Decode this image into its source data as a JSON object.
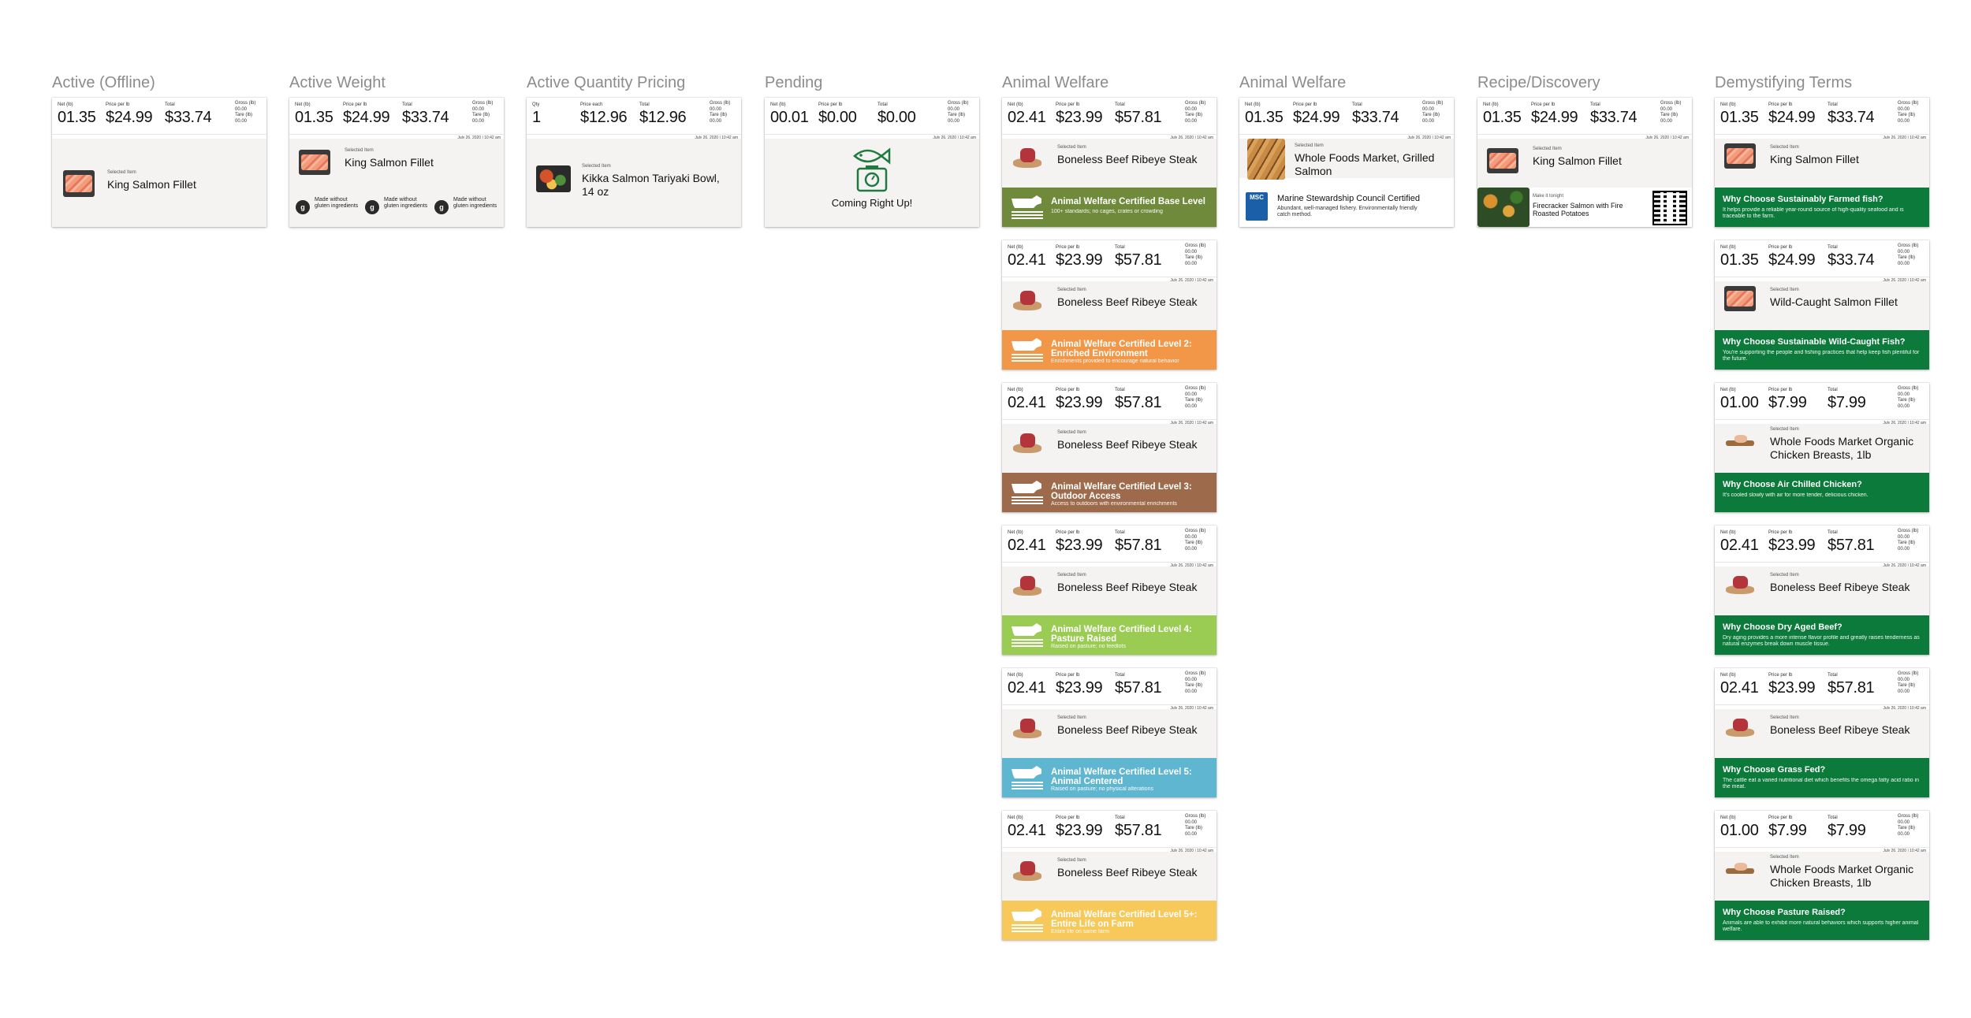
{
  "columns": [
    {
      "title": "Active (Offline)",
      "cards": [
        {
          "type": "basic",
          "qty_mode": false,
          "net_label": "Net (lb)",
          "net": "01.35",
          "price_label": "Price per lb",
          "price": "$24.99",
          "total_label": "Total",
          "total": "$33.74",
          "gross_label": "Gross (lb)",
          "gross": "00.00",
          "tare_label": "Tare (lb)",
          "tare": "00.00",
          "date": "",
          "selected_label": "Selected Item",
          "item": "King Salmon Fillet",
          "thumb": "salmon"
        }
      ]
    },
    {
      "title": "Active Weight",
      "cards": [
        {
          "type": "gluten",
          "net_label": "Net (lb)",
          "net": "01.35",
          "price_label": "Price per lb",
          "price": "$24.99",
          "total_label": "Total",
          "total": "$33.74",
          "gross_label": "Gross (lb)",
          "gross": "00.00",
          "tare_label": "Tare (lb)",
          "tare": "00.00",
          "date": "July 26, 2020 | 10:42 am",
          "selected_label": "Selected Item",
          "item": "King Salmon Fillet",
          "thumb": "salmon",
          "icons": [
            {
              "text": "Made without gluten ingredients"
            },
            {
              "text": "Made without gluten ingredients"
            },
            {
              "text": "Made without gluten ingredients"
            }
          ]
        }
      ]
    },
    {
      "title": "Active Quantity Pricing",
      "cards": [
        {
          "type": "basic",
          "net_label": "Qty",
          "net": "1",
          "price_label": "Price each",
          "price": "$12.96",
          "total_label": "Total",
          "total": "$12.96",
          "gross_label": "Gross (lb)",
          "gross": "00.00",
          "tare_label": "Tare (lb)",
          "tare": "00.00",
          "date": "July 26, 2020 | 10:42 am",
          "selected_label": "Selected Item",
          "item": "Kikka Salmon Tariyaki Bowl, 14 oz",
          "thumb": "bowl"
        }
      ]
    },
    {
      "title": "Pending",
      "cards": [
        {
          "type": "pending",
          "net_label": "Net (lb)",
          "net": "00.01",
          "price_label": "Price per lb",
          "price": "$0.00",
          "total_label": "Total",
          "total": "$0.00",
          "gross_label": "Gross (lb)",
          "gross": "00.00",
          "tare_label": "Tare (lb)",
          "tare": "00.00",
          "date": "July 26, 2020 | 10:42 am",
          "message": "Coming Right Up!"
        }
      ]
    },
    {
      "title": "Animal Welfare",
      "cards": [
        {
          "type": "welfare",
          "net_label": "Net (lb)",
          "net": "02.41",
          "price_label": "Price per lb",
          "price": "$23.99",
          "total_label": "Total",
          "total": "$57.81",
          "gross_label": "Gross (lb)",
          "gross": "00.00",
          "tare_label": "Tare (lb)",
          "tare": "00.00",
          "date": "July 26, 2020 | 10:42 am",
          "selected_label": "Selected Item",
          "item": "Boneless Beef Ribeye Steak",
          "thumb": "steak",
          "band_color": "#6e8a3a",
          "band_title": "Animal Welfare Certified Base Level",
          "band_desc": "100+ standards; no cages, crates or crowding",
          "badge_label": "ANIMAL WELFARE CERTIFIED"
        },
        {
          "type": "welfare",
          "net_label": "Net (lb)",
          "net": "02.41",
          "price_label": "Price per lb",
          "price": "$23.99",
          "total_label": "Total",
          "total": "$57.81",
          "gross_label": "Gross (lb)",
          "gross": "00.00",
          "tare_label": "Tare (lb)",
          "tare": "00.00",
          "date": "July 26, 2020 | 10:42 am",
          "selected_label": "Selected Item",
          "item": "Boneless Beef Ribeye Steak",
          "thumb": "steak",
          "band_color": "#f29748",
          "band_title": "Animal Welfare Certified Level 2: Enriched Environment",
          "band_desc": "Enrichments provided to encourage natural behavior",
          "badge_label": "ANIMAL WELFARE CERTIFIED"
        },
        {
          "type": "welfare",
          "net_label": "Net (lb)",
          "net": "02.41",
          "price_label": "Price per lb",
          "price": "$23.99",
          "total_label": "Total",
          "total": "$57.81",
          "gross_label": "Gross (lb)",
          "gross": "00.00",
          "tare_label": "Tare (lb)",
          "tare": "00.00",
          "date": "July 26, 2020 | 10:42 am",
          "selected_label": "Selected Item",
          "item": "Boneless Beef Ribeye Steak",
          "thumb": "steak",
          "band_color": "#9d6b4c",
          "band_title": "Animal Welfare Certified Level 3: Outdoor Access",
          "band_desc": "Access to outdoors with environmental enrichments",
          "badge_label": "ANIMAL WELFARE CERTIFIED"
        },
        {
          "type": "welfare",
          "net_label": "Net (lb)",
          "net": "02.41",
          "price_label": "Price per lb",
          "price": "$23.99",
          "total_label": "Total",
          "total": "$57.81",
          "gross_label": "Gross (lb)",
          "gross": "00.00",
          "tare_label": "Tare (lb)",
          "tare": "00.00",
          "date": "July 26, 2020 | 10:42 am",
          "selected_label": "Selected Item",
          "item": "Boneless Beef Ribeye Steak",
          "thumb": "steak",
          "band_color": "#9acb52",
          "band_title": "Animal Welfare Certified Level 4: Pasture Raised",
          "band_desc": "Raised on pasture; no feedlots",
          "badge_label": "ANIMAL WELFARE CERTIFIED"
        },
        {
          "type": "welfare",
          "net_label": "Net (lb)",
          "net": "02.41",
          "price_label": "Price per lb",
          "price": "$23.99",
          "total_label": "Total",
          "total": "$57.81",
          "gross_label": "Gross (lb)",
          "gross": "00.00",
          "tare_label": "Tare (lb)",
          "tare": "00.00",
          "date": "July 26, 2020 | 10:42 am",
          "selected_label": "Selected Item",
          "item": "Boneless Beef Ribeye Steak",
          "thumb": "steak",
          "band_color": "#5fb6d0",
          "band_title": "Animal Welfare Certified Level 5: Animal Centered",
          "band_desc": "Raised on pasture; no physical alterations",
          "badge_label": "ANIMAL WELFARE CERTIFIED"
        },
        {
          "type": "welfare",
          "net_label": "Net (lb)",
          "net": "02.41",
          "price_label": "Price per lb",
          "price": "$23.99",
          "total_label": "Total",
          "total": "$57.81",
          "gross_label": "Gross (lb)",
          "gross": "00.00",
          "tare_label": "Tare (lb)",
          "tare": "00.00",
          "date": "July 26, 2020 | 10:42 am",
          "selected_label": "Selected Item",
          "item": "Boneless Beef Ribeye Steak",
          "thumb": "steak",
          "band_color": "#f7c85a",
          "band_title": "Animal Welfare Certified Level 5+: Entire Life on Farm",
          "band_desc": "Entire life on same farm",
          "badge_label": "ANIMAL WELFARE CERTIFIED"
        }
      ]
    },
    {
      "title": "Animal Welfare",
      "cards": [
        {
          "type": "msc",
          "net_label": "Net (lb)",
          "net": "01.35",
          "price_label": "Price per lb",
          "price": "$24.99",
          "total_label": "Total",
          "total": "$33.74",
          "gross_label": "Gross (lb)",
          "gross": "00.00",
          "tare_label": "Tare (lb)",
          "tare": "00.00",
          "date": "July 26, 2020 | 10:42 am",
          "selected_label": "Selected Item",
          "item": "Whole Foods Market, Grilled Salmon",
          "thumb": "grilled",
          "logo_text": "MSC",
          "info_title": "Marine Stewardship Council Certified",
          "info_desc": "Abundant, well-managed fishery. Environmentally friendly catch method."
        }
      ]
    },
    {
      "title": "Recipe/Discovery",
      "cards": [
        {
          "type": "recipe",
          "net_label": "Net (lb)",
          "net": "01.35",
          "price_label": "Price per lb",
          "price": "$24.99",
          "total_label": "Total",
          "total": "$33.74",
          "gross_label": "Gross (lb)",
          "gross": "00.00",
          "tare_label": "Tare (lb)",
          "tare": "00.00",
          "date": "July 26, 2020 | 10:42 am",
          "selected_label": "Selected Item",
          "item": "King Salmon Fillet",
          "thumb": "salmon",
          "recipe_label": "Make it tonight",
          "recipe": "Firecracker Salmon with Fire Roasted Potatoes"
        }
      ]
    },
    {
      "title": "Demystifying Terms",
      "cards": [
        {
          "type": "term",
          "net_label": "Net (lb)",
          "net": "01.35",
          "price_label": "Price per lb",
          "price": "$24.99",
          "total_label": "Total",
          "total": "$33.74",
          "gross_label": "Gross (lb)",
          "gross": "00.00",
          "tare_label": "Tare (lb)",
          "tare": "00.00",
          "date": "July 26, 2020 | 10:42 am",
          "selected_label": "Selected Item",
          "item": "King Salmon Fillet",
          "thumb": "salmon",
          "term_title": "Why Choose Sustainably Farmed fish?",
          "term_desc": "It helps provide a reliable year-round source of high-quality seafood and is traceable to the farm."
        },
        {
          "type": "term",
          "net_label": "Net (lb)",
          "net": "01.35",
          "price_label": "Price per lb",
          "price": "$24.99",
          "total_label": "Total",
          "total": "$33.74",
          "gross_label": "Gross (lb)",
          "gross": "00.00",
          "tare_label": "Tare (lb)",
          "tare": "00.00",
          "date": "July 26, 2020 | 10:42 am",
          "selected_label": "Selected Item",
          "item": "Wild-Caught Salmon Fillet",
          "thumb": "salmon",
          "term_title": "Why Choose Sustainable Wild-Caught Fish?",
          "term_desc": "You're supporting the people and fishing practices that help keep fish plentiful for the future."
        },
        {
          "type": "term",
          "net_label": "Net (lb)",
          "net": "01.00",
          "price_label": "Price per lb",
          "price": "$7.99",
          "total_label": "Total",
          "total": "$7.99",
          "gross_label": "Gross (lb)",
          "gross": "00.00",
          "tare_label": "Tare (lb)",
          "tare": "00.00",
          "date": "July 26, 2020 | 10:42 am",
          "selected_label": "Selected Item",
          "item": "Whole Foods Market Organic Chicken Breasts, 1lb",
          "thumb": "chicken",
          "term_title": "Why Choose Air Chilled Chicken?",
          "term_desc": "It's cooled slowly with air for more tender, delicious chicken."
        },
        {
          "type": "term",
          "net_label": "Net (lb)",
          "net": "02.41",
          "price_label": "Price per lb",
          "price": "$23.99",
          "total_label": "Total",
          "total": "$57.81",
          "gross_label": "Gross (lb)",
          "gross": "00.00",
          "tare_label": "Tare (lb)",
          "tare": "00.00",
          "date": "July 26, 2020 | 10:42 am",
          "selected_label": "Selected Item",
          "item": "Boneless Beef Ribeye Steak",
          "thumb": "steak",
          "term_title": "Why Choose Dry Aged Beef?",
          "term_desc": "Dry aging provides a more intense flavor profile and greatly raises tenderness as natural enzymes break down muscle tissue."
        },
        {
          "type": "term",
          "net_label": "Net (lb)",
          "net": "02.41",
          "price_label": "Price per lb",
          "price": "$23.99",
          "total_label": "Total",
          "total": "$57.81",
          "gross_label": "Gross (lb)",
          "gross": "00.00",
          "tare_label": "Tare (lb)",
          "tare": "00.00",
          "date": "July 26, 2020 | 10:42 am",
          "selected_label": "Selected Item",
          "item": "Boneless Beef Ribeye Steak",
          "thumb": "steak",
          "term_title": "Why Choose Grass Fed?",
          "term_desc": "The cattle eat a varied nutritional diet which benefits the omega fatty acid ratio in the meat."
        },
        {
          "type": "term",
          "net_label": "Net (lb)",
          "net": "01.00",
          "price_label": "Price per lb",
          "price": "$7.99",
          "total_label": "Total",
          "total": "$7.99",
          "gross_label": "Gross (lb)",
          "gross": "00.00",
          "tare_label": "Tare (lb)",
          "tare": "00.00",
          "date": "July 26, 2020 | 10:42 am",
          "selected_label": "Selected Item",
          "item": "Whole Foods Market Organic Chicken Breasts, 1lb",
          "thumb": "chicken",
          "term_title": "Why Choose Pasture Raised?",
          "term_desc": "Animals are able to exhibit more natural behaviors which supports higher animal welfare."
        }
      ]
    }
  ],
  "colors": {
    "term_band": "#0b7a3a",
    "title_gray": "#8c8c8c",
    "card_body": "#f4f3f1",
    "pending_icon": "#1f7a3f"
  }
}
